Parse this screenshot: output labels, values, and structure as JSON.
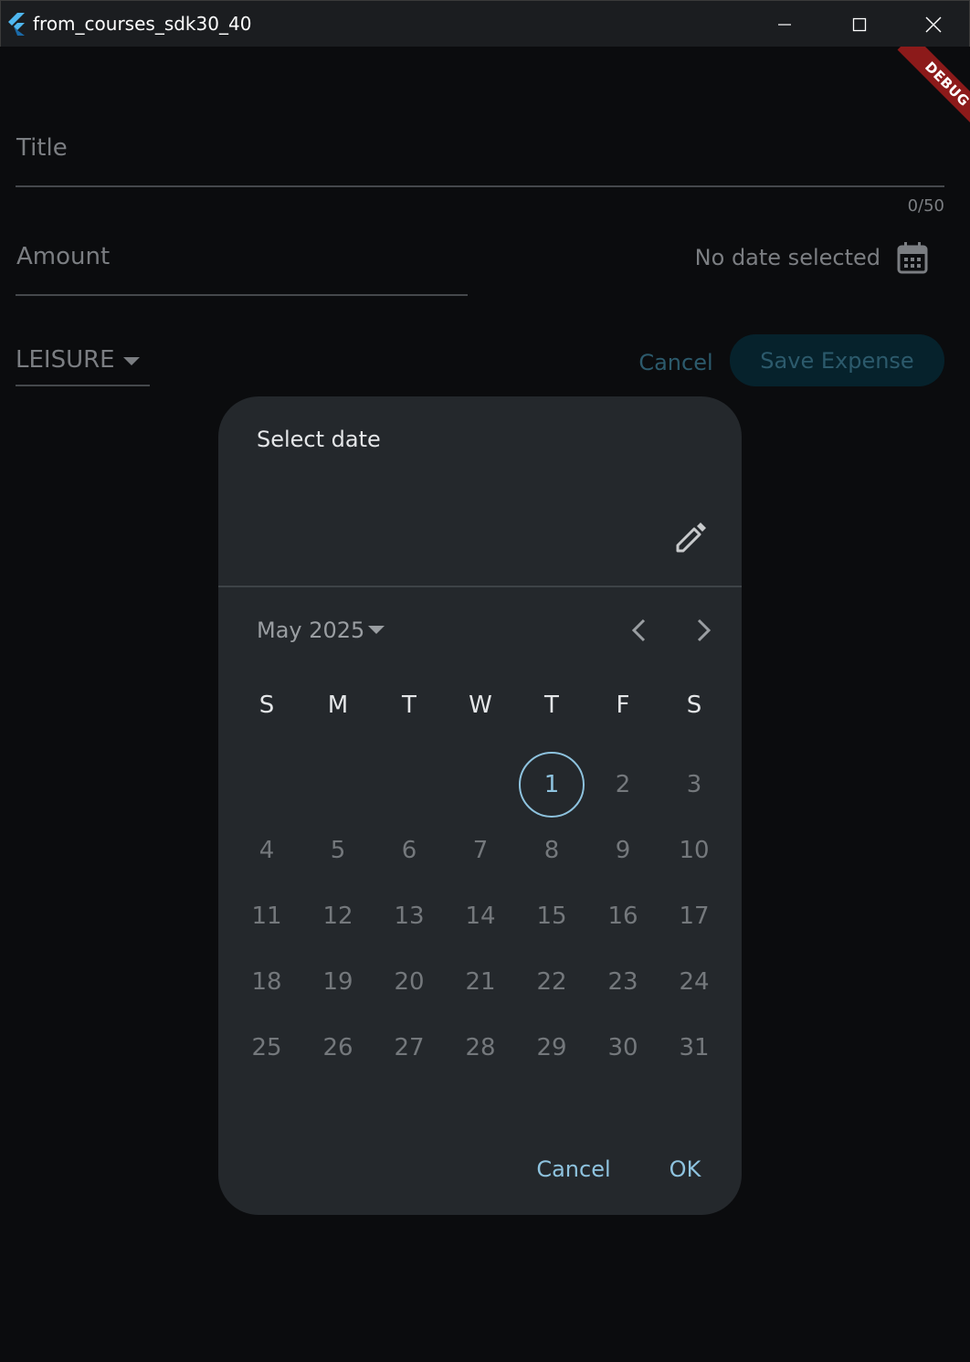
{
  "window": {
    "title": "from_courses_sdk30_40"
  },
  "banner": {
    "label": "DEBUG"
  },
  "form": {
    "title_placeholder": "Title",
    "title_counter": "0/50",
    "amount_placeholder": "Amount",
    "date_text": "No date selected",
    "category_value": "LEISURE",
    "cancel_label": "Cancel",
    "save_label": "Save Expense"
  },
  "date_picker": {
    "title": "Select date",
    "month_label": "May 2025",
    "weekdays": [
      "S",
      "M",
      "T",
      "W",
      "T",
      "F",
      "S"
    ],
    "first_weekday_index": 4,
    "days_in_month": 31,
    "today": 1,
    "cancel_label": "Cancel",
    "ok_label": "OK"
  },
  "colors": {
    "accent": "#8ec3df",
    "disabled_button_text": "#2c5a6c",
    "dialog_bg": "#24282c",
    "page_bg": "#0b0c0e",
    "debug_banner": "#8c1a1a"
  },
  "icons": {
    "app": "flutter-logo-icon",
    "calendar": "calendar-icon",
    "edit": "pencil-icon",
    "prev": "chevron-left-icon",
    "next": "chevron-right-icon",
    "dropdown": "caret-down-icon"
  }
}
